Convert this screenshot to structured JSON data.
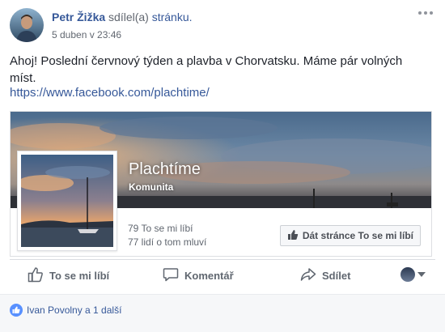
{
  "post": {
    "author": "Petr Žižka",
    "shared_text": "sdílel(a)",
    "page_link": "stránku.",
    "timestamp": "5 duben v 23:46",
    "text": "Ahoj! Poslední červnový týden a plavba v Chorvatsku. Máme pár volných míst.",
    "url": "https://www.facebook.com/plachtime/"
  },
  "card": {
    "page_name": "Plachtíme",
    "category": "Komunita",
    "likes_text": "79 To se mi líbí",
    "talking_text": "77 lidí o tom mluví",
    "like_page_label": "Dát stránce To se mi líbí"
  },
  "actions": {
    "like": "To se mi líbí",
    "comment": "Komentář",
    "share": "Sdílet"
  },
  "reactions": {
    "text": "Ivan Povolny a 1 další"
  },
  "icons": {
    "more": "more-options-icon",
    "like": "thumbs-up-icon",
    "comment": "comment-bubble-icon",
    "share": "share-arrow-icon",
    "reaction": "like-reaction-icon"
  },
  "colors": {
    "link": "#365899",
    "meta": "#616770",
    "button_text": "#606770",
    "like_blue": "#5890ff"
  }
}
